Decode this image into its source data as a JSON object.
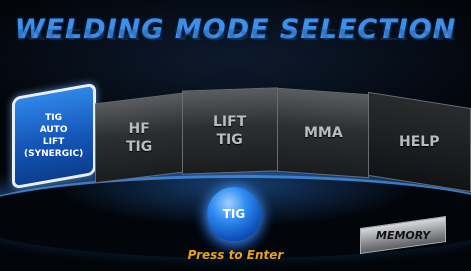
{
  "title": "WELDING MODE SELECTION",
  "modes": {
    "active": [
      "TIG",
      "AUTO",
      "LIFT",
      "(SYNERGIC)"
    ],
    "hf": [
      "HF",
      "TIG"
    ],
    "lift": [
      "LIFT",
      "TIG"
    ],
    "mma": "MMA",
    "help": "HELP"
  },
  "selected_label": "TIG",
  "enter_hint": "Press to Enter",
  "memory_label": "MEMORY",
  "colors": {
    "accent_blue": "#2f86e8",
    "title_blue": "#3f8fe6",
    "hint_orange": "#e8a21c"
  }
}
